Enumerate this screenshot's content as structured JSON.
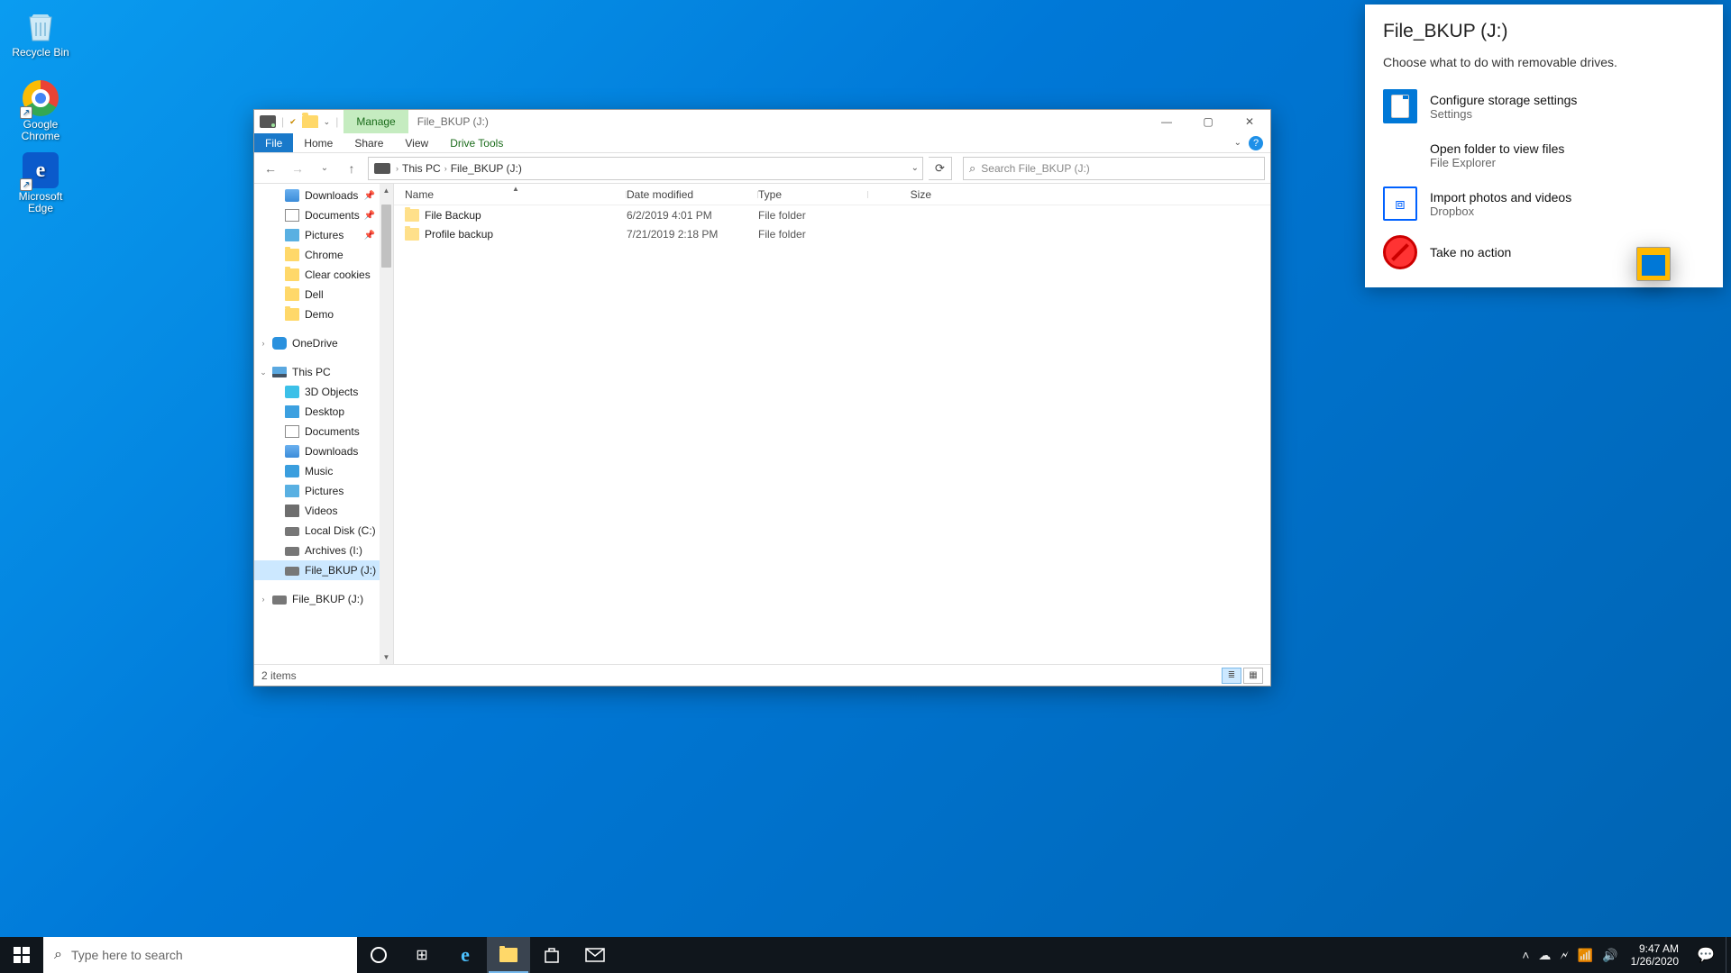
{
  "desktop": {
    "icons": [
      {
        "name": "recycle-bin",
        "label": "Recycle Bin"
      },
      {
        "name": "google-chrome",
        "label": "Google Chrome"
      },
      {
        "name": "microsoft-edge",
        "label": "Microsoft Edge"
      }
    ]
  },
  "explorer": {
    "contextual_group": "Manage",
    "contextual_tab": "Drive Tools",
    "window_title": "File_BKUP (J:)",
    "tabs": {
      "file": "File",
      "home": "Home",
      "share": "Share",
      "view": "View"
    },
    "breadcrumb": [
      "This PC",
      "File_BKUP (J:)"
    ],
    "search_placeholder": "Search File_BKUP (J:)",
    "nav": {
      "quick": [
        {
          "label": "Downloads",
          "icon": "dl",
          "pinned": true
        },
        {
          "label": "Documents",
          "icon": "doc",
          "pinned": true
        },
        {
          "label": "Pictures",
          "icon": "pic",
          "pinned": true
        },
        {
          "label": "Chrome",
          "icon": "folder"
        },
        {
          "label": "Clear cookies",
          "icon": "folder"
        },
        {
          "label": "Dell",
          "icon": "folder"
        },
        {
          "label": "Demo",
          "icon": "folder"
        }
      ],
      "onedrive": "OneDrive",
      "thispc": "This PC",
      "thispc_children": [
        {
          "label": "3D Objects",
          "icon": "obj"
        },
        {
          "label": "Desktop",
          "icon": "desk"
        },
        {
          "label": "Documents",
          "icon": "doc"
        },
        {
          "label": "Downloads",
          "icon": "dl"
        },
        {
          "label": "Music",
          "icon": "music"
        },
        {
          "label": "Pictures",
          "icon": "pic"
        },
        {
          "label": "Videos",
          "icon": "video"
        },
        {
          "label": "Local Disk (C:)",
          "icon": "drive"
        },
        {
          "label": "Archives (I:)",
          "icon": "drive"
        },
        {
          "label": "File_BKUP (J:)",
          "icon": "drive",
          "selected": true
        }
      ],
      "extra": [
        {
          "label": "File_BKUP (J:)",
          "icon": "drive"
        }
      ]
    },
    "columns": {
      "name": "Name",
      "date": "Date modified",
      "type": "Type",
      "size": "Size"
    },
    "rows": [
      {
        "name": "File Backup",
        "date": "6/2/2019 4:01 PM",
        "type": "File folder",
        "size": ""
      },
      {
        "name": "Profile backup",
        "date": "7/21/2019 2:18 PM",
        "type": "File folder",
        "size": ""
      }
    ],
    "status": "2 items"
  },
  "autoplay": {
    "title": "File_BKUP (J:)",
    "prompt": "Choose what to do with removable drives.",
    "options": [
      {
        "title": "Configure storage settings",
        "sub": "Settings",
        "icon": "settings"
      },
      {
        "title": "Open folder to view files",
        "sub": "File Explorer",
        "icon": "explorer"
      },
      {
        "title": "Import photos and videos",
        "sub": "Dropbox",
        "icon": "dropbox"
      },
      {
        "title": "Take no action",
        "sub": "",
        "icon": "noaction"
      }
    ]
  },
  "taskbar": {
    "search_placeholder": "Type here to search",
    "time": "9:47 AM",
    "date": "1/26/2020"
  }
}
